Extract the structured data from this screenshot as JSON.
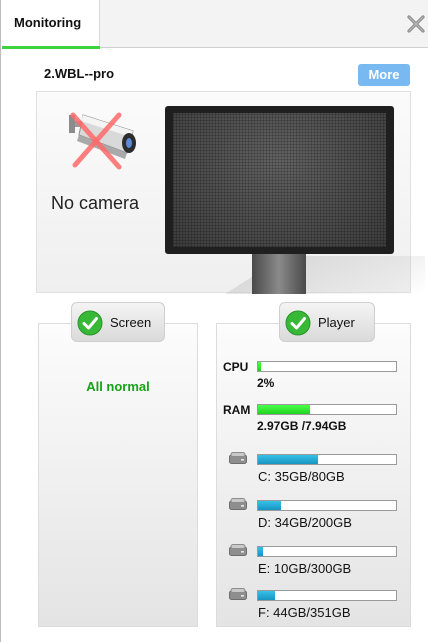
{
  "header": {
    "tab_label": "Monitoring",
    "close_icon": "close-icon"
  },
  "device": {
    "name": "2.WBL--pro",
    "more_label": "More"
  },
  "preview": {
    "camera_status": "No camera",
    "camera_icon": "no-camera-icon",
    "monitor_icon": "monitor-icon"
  },
  "screen_panel": {
    "title": "Screen",
    "status": "All normal",
    "status_color": "#16a116"
  },
  "player_panel": {
    "title": "Player",
    "cpu": {
      "label": "CPU",
      "value": "2%",
      "fraction": 0.02
    },
    "ram": {
      "label": "RAM",
      "value": "2.97GB /7.94GB",
      "fraction": 0.374
    },
    "disks": [
      {
        "text": "C: 35GB/80GB",
        "fraction": 0.4375
      },
      {
        "text": "D: 34GB/200GB",
        "fraction": 0.17
      },
      {
        "text": "E: 10GB/300GB",
        "fraction": 0.033
      },
      {
        "text": "F: 44GB/351GB",
        "fraction": 0.125
      }
    ]
  },
  "colors": {
    "accent_green": "#3fd23f",
    "more_button_blue": "#79b9f1",
    "disk_bar_blue": "#1794c0"
  }
}
